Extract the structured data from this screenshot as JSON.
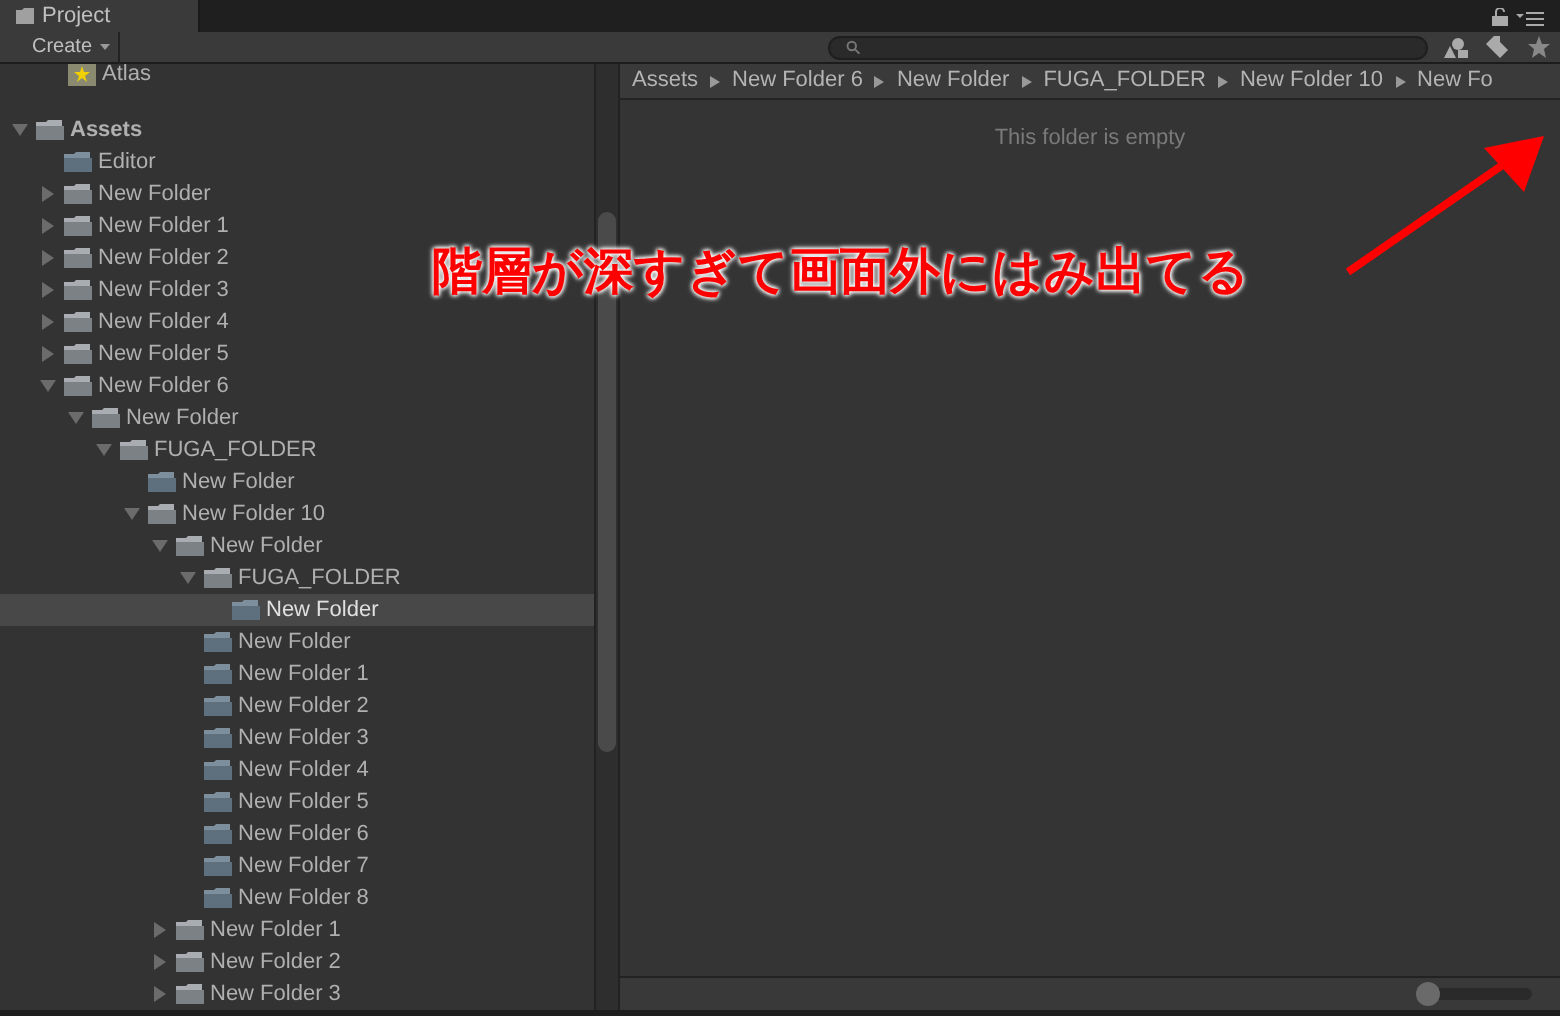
{
  "tab": {
    "title": "Project"
  },
  "toolbar": {
    "create_label": "Create"
  },
  "favorites": [
    {
      "label": "Atlas"
    }
  ],
  "tree": [
    {
      "label": "Assets",
      "expanded": true,
      "selected": false,
      "children": [
        {
          "label": "Editor",
          "selected": false
        },
        {
          "label": "New Folder",
          "expanded": false,
          "selected": false
        },
        {
          "label": "New Folder 1",
          "expanded": false,
          "selected": false
        },
        {
          "label": "New Folder 2",
          "expanded": false,
          "selected": false
        },
        {
          "label": "New Folder 3",
          "expanded": false,
          "selected": false
        },
        {
          "label": "New Folder 4",
          "expanded": false,
          "selected": false
        },
        {
          "label": "New Folder 5",
          "expanded": false,
          "selected": false
        },
        {
          "label": "New Folder 6",
          "expanded": true,
          "selected": false,
          "children": [
            {
              "label": "New Folder",
              "expanded": true,
              "selected": false,
              "children": [
                {
                  "label": "FUGA_FOLDER",
                  "expanded": true,
                  "selected": false,
                  "children": [
                    {
                      "label": "New Folder",
                      "selected": false
                    },
                    {
                      "label": "New Folder 10",
                      "expanded": true,
                      "selected": false,
                      "children": [
                        {
                          "label": "New Folder",
                          "expanded": true,
                          "selected": false,
                          "children": [
                            {
                              "label": "FUGA_FOLDER",
                              "expanded": true,
                              "selected": false,
                              "children": [
                                {
                                  "label": "New Folder",
                                  "selected": true
                                }
                              ]
                            },
                            {
                              "label": "New Folder",
                              "selected": false
                            },
                            {
                              "label": "New Folder 1",
                              "selected": false
                            },
                            {
                              "label": "New Folder 2",
                              "selected": false
                            },
                            {
                              "label": "New Folder 3",
                              "selected": false
                            },
                            {
                              "label": "New Folder 4",
                              "selected": false
                            },
                            {
                              "label": "New Folder 5",
                              "selected": false
                            },
                            {
                              "label": "New Folder 6",
                              "selected": false
                            },
                            {
                              "label": "New Folder 7",
                              "selected": false
                            },
                            {
                              "label": "New Folder 8",
                              "selected": false
                            }
                          ]
                        },
                        {
                          "label": "New Folder 1",
                          "expanded": false,
                          "selected": false
                        },
                        {
                          "label": "New Folder 2",
                          "expanded": false,
                          "selected": false
                        },
                        {
                          "label": "New Folder 3",
                          "expanded": false,
                          "selected": false
                        }
                      ]
                    }
                  ]
                }
              ]
            }
          ]
        }
      ]
    }
  ],
  "breadcrumb": [
    "Assets",
    "New Folder 6",
    "New Folder",
    "FUGA_FOLDER",
    "New Folder 10",
    "New Fo"
  ],
  "empty_message": "This folder is empty",
  "annotation": {
    "text": "階層が深すぎて画面外にはみ出てる"
  },
  "zoom_slider": {
    "level": 0
  }
}
